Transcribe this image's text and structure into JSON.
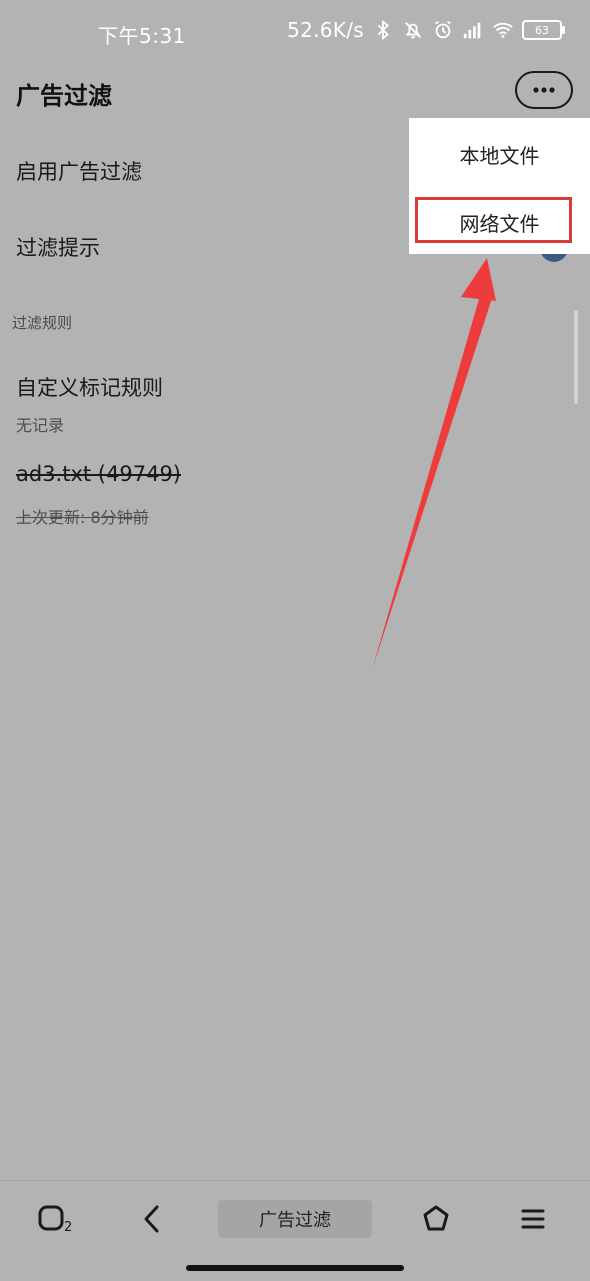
{
  "status_bar": {
    "time": "下午5:31",
    "net_speed": "52.6K/s",
    "battery_level": "63",
    "icons": [
      "bluetooth-icon",
      "mute-bell-icon",
      "alarm-icon",
      "hd-signal-icon",
      "wifi-icon",
      "battery-icon"
    ]
  },
  "header": {
    "title": "广告过滤",
    "more_icon": "more-dots-icon"
  },
  "settings": {
    "enable_ad_filter": "启用广告过滤",
    "filter_hint": "过滤提示"
  },
  "rules_section": {
    "label": "过滤规则",
    "custom_rules_title": "自定义标记规则",
    "custom_rules_sub": "无记录",
    "file_title": "ad3.txt (49749)",
    "file_sub": "上次更新: 8分钟前"
  },
  "popup_menu": {
    "items": [
      "本地文件",
      "网络文件"
    ]
  },
  "bottom_bar": {
    "tabs_count": "2",
    "tab_label": "广告过滤",
    "icons": [
      "tabs-icon",
      "back-icon",
      "home-icon",
      "menu-icon"
    ]
  },
  "colors": {
    "background": "#b3b3b3",
    "highlight": "#d93a3a",
    "arrow": "#ee3c3c",
    "toggle": "#3d5a86"
  }
}
